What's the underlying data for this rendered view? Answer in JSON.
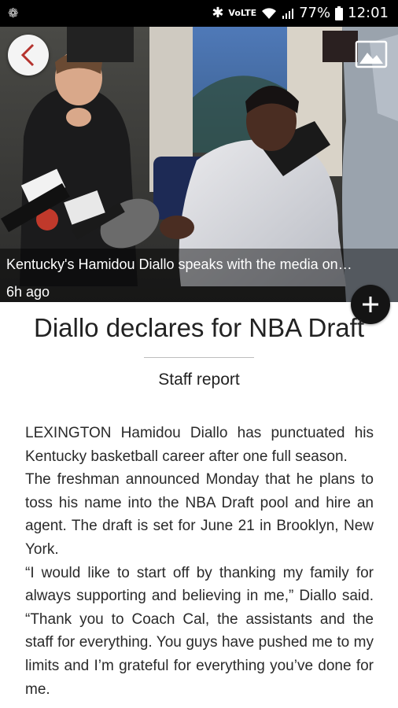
{
  "status_bar": {
    "left_icon": "notification-icon",
    "battery_percent": "77%",
    "time": "12:01",
    "network_label": "VoLTE"
  },
  "hero": {
    "caption": "Kentucky's Hamidou Diallo speaks with the media on…",
    "time_ago": "6h ago"
  },
  "article": {
    "headline": "Diallo declares for NBA Draft",
    "byline": "Staff report",
    "paragraphs": [
      "LEXINGTON Hamidou Diallo has punctuated his Kentucky basketball career after one full season.",
      "The freshman announced Monday that he plans to toss his name into the NBA Draft pool and hire an agent. The draft is set for June 21 in Brooklyn, New York.",
      "“I would like to start off by thanking my family for always supporting and believing in me,” Diallo said. “Thank you to Coach Cal, the assistants and the staff for everything. You guys have pushed me to my limits and I’m grateful for everything you’ve done for me."
    ]
  },
  "colors": {
    "back_chevron": "#b5332e",
    "status_bar_bg": "#000000",
    "plus_button_bg": "#141414"
  }
}
